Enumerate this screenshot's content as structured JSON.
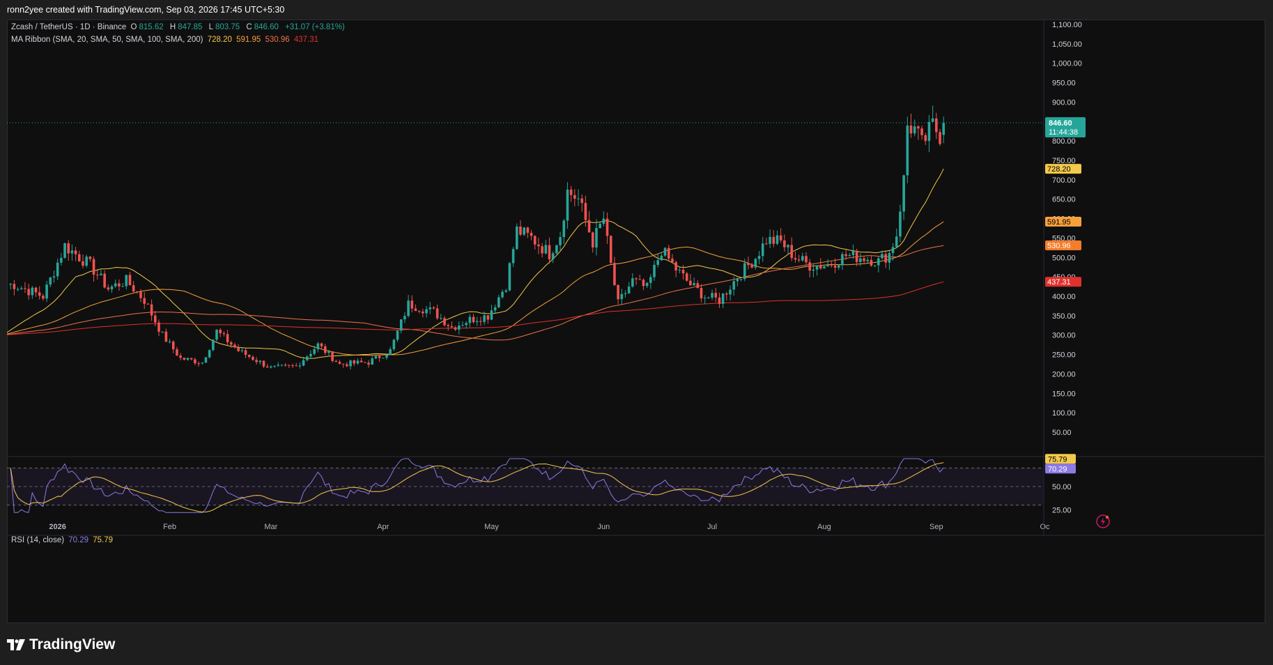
{
  "header": {
    "title": "ronn2yee created with TradingView.com, Sep 03, 2026 17:45 UTC+5:30"
  },
  "legend": {
    "symbol": "Zcash / TetherUS · 1D · Binance",
    "o_label": "O",
    "o": "815.62",
    "h_label": "H",
    "h": "847.85",
    "l_label": "L",
    "l": "803.75",
    "c_label": "C",
    "c": "846.60",
    "change": "+31.07 (+3.81%)",
    "ma_name": "MA Ribbon (SMA, 20, SMA, 50, SMA, 100, SMA, 200)",
    "ma20": "728.20",
    "ma50": "591.95",
    "ma100": "530.96",
    "ma200": "437.31",
    "rsi_name": "RSI (14, close)",
    "rsi": "70.29",
    "rsi_ma": "75.79"
  },
  "price_tag": {
    "price": "846.60",
    "countdown": "11:44:38"
  },
  "footer": {
    "brand": "TradingView"
  },
  "icons": {
    "alert": "lightning-alert-icon",
    "logo": "tradingview-logo-icon"
  },
  "colors": {
    "up": "#26a69a",
    "down": "#ef5350",
    "ma20": "#f2c94c",
    "ma50": "#f7a03b",
    "ma100": "#f0714a",
    "ma200": "#e0312d",
    "rsi": "#8c7ae6",
    "rsi_ma": "#f2c94c"
  },
  "chart_data": {
    "type": "candlestick",
    "symbol": "Zcash / TetherUS",
    "interval": "1D",
    "exchange": "Binance",
    "ylim": [
      0,
      1100
    ],
    "y_ticks": [
      "1,100.00",
      "1,050.00",
      "1,000.00",
      "950.00",
      "900.00",
      "850.00",
      "800.00",
      "750.00",
      "700.00",
      "650.00",
      "600.00",
      "550.00",
      "500.00",
      "450.00",
      "400.00",
      "350.00",
      "300.00",
      "250.00",
      "200.00",
      "150.00",
      "100.00",
      "50.00"
    ],
    "x_ticks": [
      "2026",
      "Feb",
      "Mar",
      "Apr",
      "May",
      "Jun",
      "Jul",
      "Aug",
      "Sep",
      "Oc"
    ],
    "close_anchors": [
      {
        "date": "2025-12-20",
        "close": 430
      },
      {
        "date": "2025-12-28",
        "close": 400
      },
      {
        "date": "2026-01-03",
        "close": 530
      },
      {
        "date": "2026-01-10",
        "close": 480
      },
      {
        "date": "2026-01-15",
        "close": 420
      },
      {
        "date": "2026-01-20",
        "close": 440
      },
      {
        "date": "2026-01-25",
        "close": 390
      },
      {
        "date": "2026-01-30",
        "close": 300
      },
      {
        "date": "2026-02-04",
        "close": 240
      },
      {
        "date": "2026-02-10",
        "close": 230
      },
      {
        "date": "2026-02-14",
        "close": 310
      },
      {
        "date": "2026-02-20",
        "close": 260
      },
      {
        "date": "2026-03-01",
        "close": 215
      },
      {
        "date": "2026-03-08",
        "close": 220
      },
      {
        "date": "2026-03-14",
        "close": 275
      },
      {
        "date": "2026-03-20",
        "close": 225
      },
      {
        "date": "2026-03-28",
        "close": 230
      },
      {
        "date": "2026-04-03",
        "close": 260
      },
      {
        "date": "2026-04-08",
        "close": 380
      },
      {
        "date": "2026-04-15",
        "close": 360
      },
      {
        "date": "2026-04-20",
        "close": 320
      },
      {
        "date": "2026-04-25",
        "close": 340
      },
      {
        "date": "2026-04-30",
        "close": 350
      },
      {
        "date": "2026-05-05",
        "close": 430
      },
      {
        "date": "2026-05-08",
        "close": 570
      },
      {
        "date": "2026-05-12",
        "close": 550
      },
      {
        "date": "2026-05-17",
        "close": 510
      },
      {
        "date": "2026-05-20",
        "close": 560
      },
      {
        "date": "2026-05-22",
        "close": 670
      },
      {
        "date": "2026-05-25",
        "close": 650
      },
      {
        "date": "2026-05-29",
        "close": 540
      },
      {
        "date": "2026-06-01",
        "close": 600
      },
      {
        "date": "2026-06-03",
        "close": 480
      },
      {
        "date": "2026-06-05",
        "close": 380
      },
      {
        "date": "2026-06-09",
        "close": 440
      },
      {
        "date": "2026-06-13",
        "close": 420
      },
      {
        "date": "2026-06-17",
        "close": 520
      },
      {
        "date": "2026-06-21",
        "close": 470
      },
      {
        "date": "2026-06-25",
        "close": 430
      },
      {
        "date": "2026-06-29",
        "close": 400
      },
      {
        "date": "2026-07-03",
        "close": 390
      },
      {
        "date": "2026-07-08",
        "close": 450
      },
      {
        "date": "2026-07-13",
        "close": 500
      },
      {
        "date": "2026-07-16",
        "close": 545
      },
      {
        "date": "2026-07-20",
        "close": 540
      },
      {
        "date": "2026-07-24",
        "close": 500
      },
      {
        "date": "2026-07-28",
        "close": 480
      },
      {
        "date": "2026-08-02",
        "close": 480
      },
      {
        "date": "2026-08-07",
        "close": 505
      },
      {
        "date": "2026-08-12",
        "close": 500
      },
      {
        "date": "2026-08-16",
        "close": 490
      },
      {
        "date": "2026-08-19",
        "close": 510
      },
      {
        "date": "2026-08-21",
        "close": 560
      },
      {
        "date": "2026-08-23",
        "close": 700
      },
      {
        "date": "2026-08-24",
        "close": 840
      },
      {
        "date": "2026-08-26",
        "close": 830
      },
      {
        "date": "2026-08-28",
        "close": 790
      },
      {
        "date": "2026-08-31",
        "close": 840
      },
      {
        "date": "2026-09-02",
        "close": 815.62
      },
      {
        "date": "2026-09-03",
        "close": 846.6
      }
    ],
    "last_candle": {
      "date": "2026-09-03",
      "open": 815.62,
      "high": 847.85,
      "low": 803.75,
      "close": 846.6,
      "change": 31.07,
      "change_pct": 3.81
    },
    "moving_averages": [
      {
        "name": "SMA 20",
        "last": 728.2
      },
      {
        "name": "SMA 50",
        "last": 591.95
      },
      {
        "name": "SMA 100",
        "last": 530.96
      },
      {
        "name": "SMA 200",
        "last": 437.31
      }
    ],
    "rsi": {
      "name": "RSI (14, close)",
      "last": 70.29,
      "ma_last": 75.79,
      "ylim": [
        20,
        80
      ],
      "y_ticks": [
        "50.00",
        "25.00"
      ],
      "bands": [
        70,
        50,
        30
      ]
    }
  }
}
